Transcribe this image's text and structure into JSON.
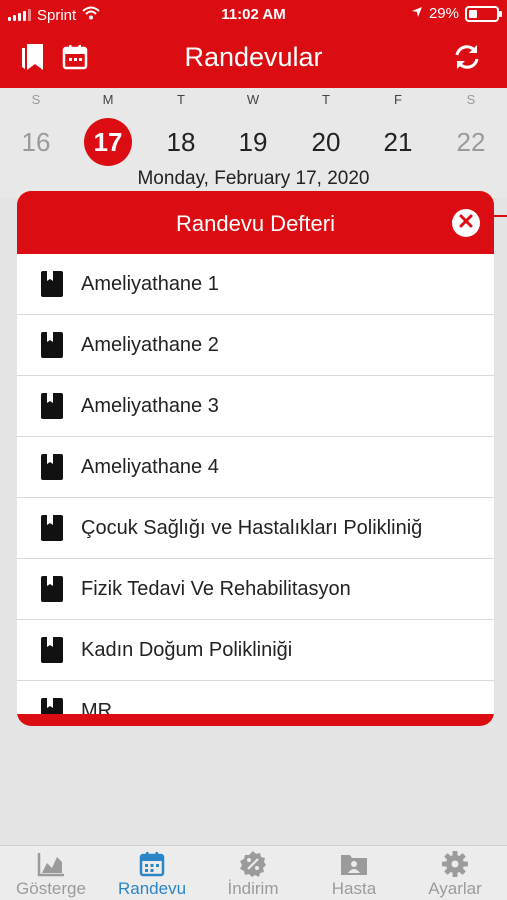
{
  "status_bar": {
    "carrier": "Sprint",
    "time": "11:02 AM",
    "battery": "29%",
    "battery_level": 0.29
  },
  "header": {
    "title": "Randevular",
    "left_icons": [
      "bookmarks-icon",
      "calendar-icon"
    ],
    "right_icon": "refresh-icon"
  },
  "week": {
    "days": [
      {
        "letter": "S",
        "number": "16",
        "muted": true
      },
      {
        "letter": "M",
        "number": "17",
        "selected": true
      },
      {
        "letter": "T",
        "number": "18"
      },
      {
        "letter": "W",
        "number": "19"
      },
      {
        "letter": "T",
        "number": "20"
      },
      {
        "letter": "F",
        "number": "21"
      },
      {
        "letter": "S",
        "number": "22",
        "muted": true
      }
    ],
    "full_date": "Monday, February 17, 2020"
  },
  "modal": {
    "title": "Randevu Defteri",
    "items": [
      "Ameliyathane 1",
      "Ameliyathane 2",
      "Ameliyathane 3",
      "Ameliyathane 4",
      "Çocuk Sağlığı ve Hastalıkları Polikliniğ",
      "Fizik Tedavi Ve Rehabilitasyon",
      "Kadın Doğum Polikliniği",
      "MR"
    ]
  },
  "tabs": [
    {
      "label": "Gösterge",
      "icon": "chart-icon"
    },
    {
      "label": "Randevu",
      "icon": "calendar-icon",
      "active": true
    },
    {
      "label": "İndirim",
      "icon": "discount-icon"
    },
    {
      "label": "Hasta",
      "icon": "patient-folder-icon"
    },
    {
      "label": "Ayarlar",
      "icon": "gear-icon"
    }
  ],
  "colors": {
    "brand_red": "#dc0d12",
    "active_tab": "#2a86c7",
    "inactive_tab": "#9b9b9b"
  }
}
